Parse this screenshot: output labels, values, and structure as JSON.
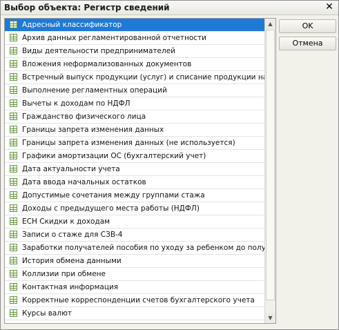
{
  "window": {
    "title": "Выбор объекта: Регистр сведений",
    "close_glyph": "✕"
  },
  "list": {
    "selected_index": 0,
    "items": [
      "Адресный классификатор",
      "Архив данных регламентированной отчетности",
      "Виды деятельности предпринимателей",
      "Вложения неформализованных документов",
      "Встречный выпуск продукции (услуг) и списание продукции на со...",
      "Выполнение регламентных операций",
      "Вычеты к доходам по НДФЛ",
      "Гражданство физического лица",
      "Границы запрета изменения данных",
      "Границы запрета изменения данных (не используется)",
      "Графики амортизации ОС (бухгалтерский учет)",
      "Дата актуальности учета",
      "Дата ввода начальных остатков",
      "Допустимые сочетания между группами стажа",
      "Доходы с предыдущего места работы (НДФЛ)",
      "ЕСН Скидки к доходам",
      "Записи о стаже для СЗВ-4",
      "Заработки получателей пособия по уходу за ребенком до полутор...",
      "История обмена данными",
      "Коллизии при обмене",
      "Контактная информация",
      "Корректные корреспонденции счетов бухгалтерского учета",
      "Курсы валют"
    ],
    "icon": "table-register-icon"
  },
  "buttons": {
    "ok_label": "OK",
    "cancel_label": "Отмена"
  },
  "scrollbar": {
    "up_glyph": "▲",
    "down_glyph": "▼"
  }
}
